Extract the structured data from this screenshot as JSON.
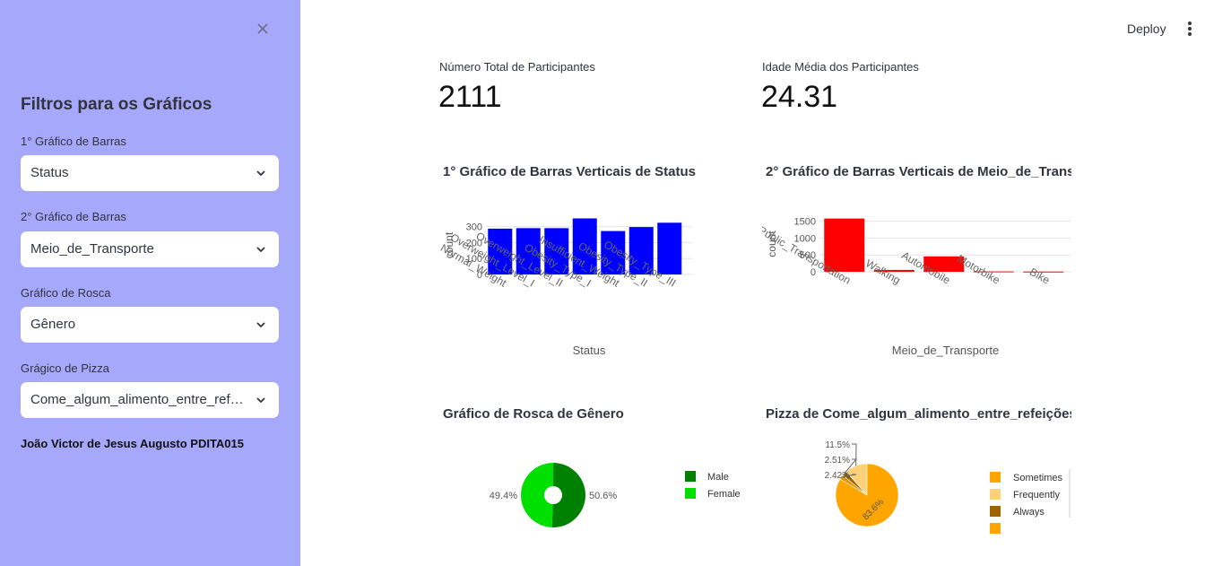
{
  "sidebar": {
    "title": "Filtros para os Gráficos",
    "filters": [
      {
        "label": "1° Gráfico de Barras",
        "value": "Status"
      },
      {
        "label": "2° Gráfico de Barras",
        "value": "Meio_de_Transporte"
      },
      {
        "label": "Gráfico de Rosca",
        "value": "Gênero"
      },
      {
        "label": "Grágico de Pizza",
        "value": "Come_algum_alimento_entre_refeições"
      }
    ],
    "author": "João Victor de Jesus Augusto PDITA015"
  },
  "header": {
    "deploy_label": "Deploy"
  },
  "metrics": {
    "total_label": "Número Total de Participantes",
    "total_value": "2111",
    "age_label": "Idade Média dos Participantes",
    "age_value": "24.31"
  },
  "colors": {
    "sidebar_bg": "#a6a8fb",
    "bar1": "#0000ff",
    "bar2": "#ff0000",
    "male": "#008000",
    "female": "#00e000",
    "sometimes": "#ffa500",
    "frequently": "#ffd07a",
    "always": "#9c6300"
  },
  "chart_data": [
    {
      "type": "bar",
      "title": "1° Gráfico de Barras Verticais de Status",
      "xlabel": "Status",
      "ylabel": "count",
      "categories": [
        "Normal_Weight",
        "Overweight_Level_I",
        "Overweight_Level_II",
        "Obesity_Type_I",
        "Insufficient_Weight",
        "Obesity_Type_II",
        "Obesity_Type_III"
      ],
      "values": [
        287,
        290,
        290,
        351,
        272,
        297,
        324
      ],
      "yticks": [
        0,
        100,
        200,
        300
      ],
      "ylim": [
        0,
        365
      ],
      "grid": true
    },
    {
      "type": "bar",
      "title": "2° Gráfico de Barras Verticais de Meio_de_Transporte",
      "xlabel": "Meio_de_Transporte",
      "ylabel": "count",
      "categories": [
        "Public_Transportation",
        "Walking",
        "Automobile",
        "Motorbike",
        "Bike"
      ],
      "values": [
        1580,
        56,
        457,
        11,
        7
      ],
      "yticks": [
        0,
        500,
        1000,
        1500
      ],
      "ylim": [
        0,
        1650
      ],
      "grid": true
    },
    {
      "type": "pie",
      "title": "Gráfico de Rosca de Gênero",
      "labels": [
        "Male",
        "Female"
      ],
      "values": [
        50.6,
        49.4
      ],
      "value_labels": [
        "50.6%",
        "49.4%"
      ],
      "hole": true,
      "legend": "right"
    },
    {
      "type": "pie",
      "title": "Pizza de Come_algum_alimento_entre_refeições",
      "labels": [
        "Sometimes",
        "Frequently",
        "Always",
        "no"
      ],
      "values": [
        83.6,
        11.5,
        2.51,
        2.42
      ],
      "value_labels": [
        "83.6%",
        "11.5%",
        "2.51%",
        "2.42%"
      ],
      "hole": false,
      "legend": "right"
    }
  ]
}
